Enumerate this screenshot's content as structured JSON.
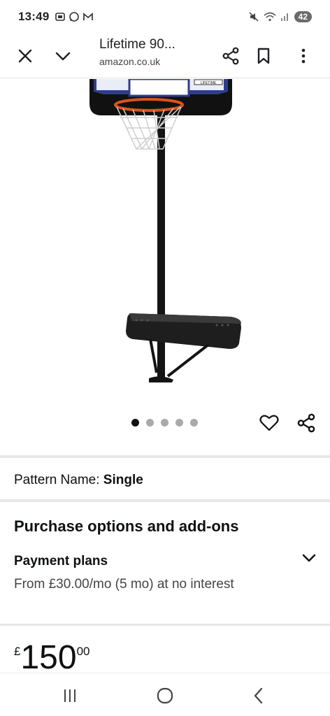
{
  "status_bar": {
    "time": "13:49",
    "battery": "42"
  },
  "browser": {
    "title": "Lifetime 90...",
    "url": "amazon.co.uk"
  },
  "product": {
    "image_icon": "basketball-hoop-image",
    "backboard_brand": "LIFETIME",
    "carousel_total": 5,
    "carousel_active": 1
  },
  "pattern": {
    "label": "Pattern Name:",
    "value": "Single"
  },
  "purchase": {
    "section_title": "Purchase options and add-ons",
    "payment_title": "Payment plans",
    "payment_desc": "From £30.00/mo (5 mo) at no interest"
  },
  "price": {
    "currency": "£",
    "whole": "150",
    "fraction": "00"
  },
  "colors": {
    "accent": "#0f1111",
    "divider": "#e7e7e7"
  }
}
